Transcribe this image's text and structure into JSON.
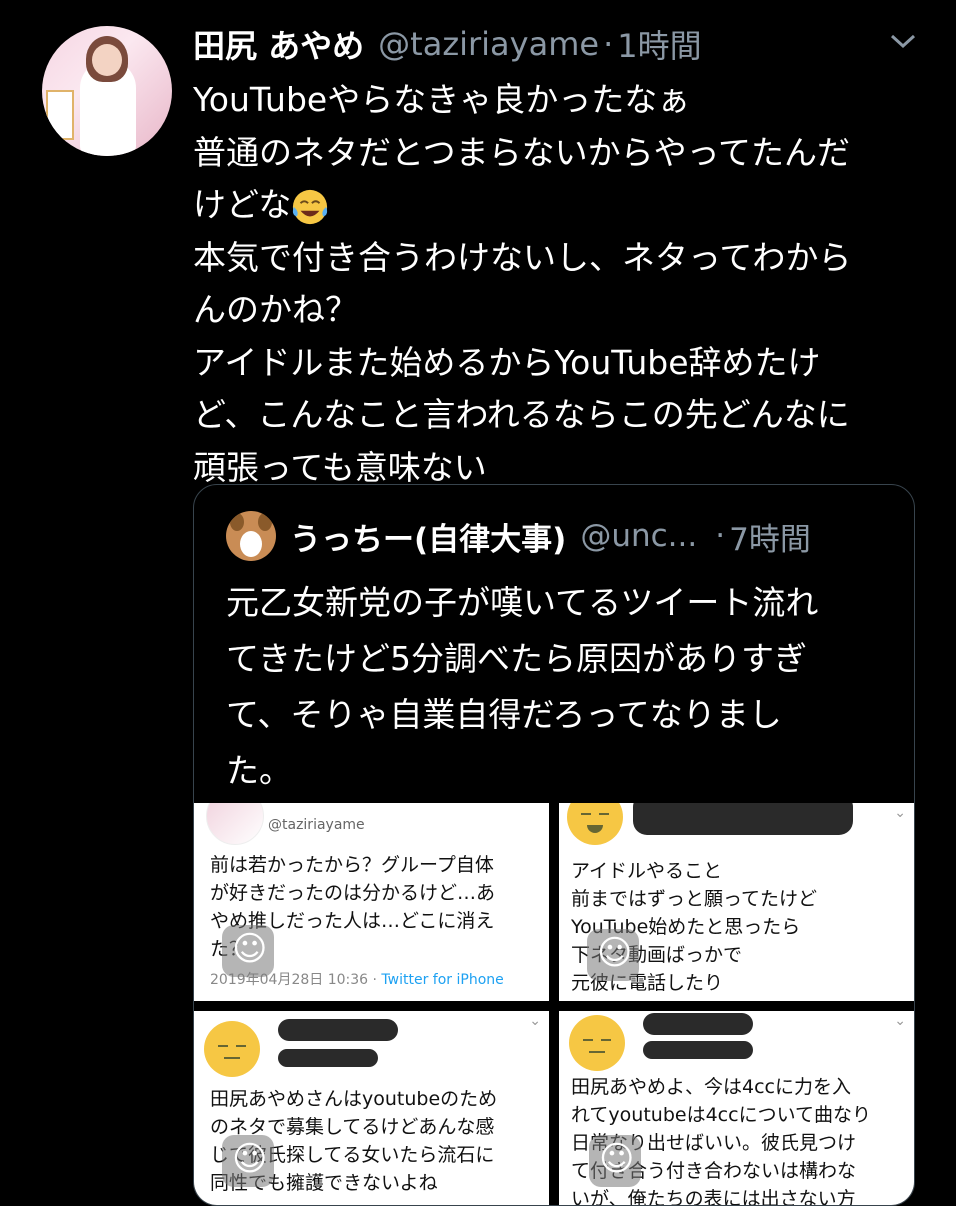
{
  "tweet": {
    "name": "田尻 あやめ",
    "handle": "@taziriayame",
    "dot": "·",
    "time": "1時間",
    "lines": [
      "YouTubeやらなきゃ良かったなぁ",
      "普通のネタだとつまらないからやってたんだ",
      "けどな",
      "本気で付き合うわけないし、ネタってわから",
      "んのかね？",
      "アイドルまた始めるからYouTube辞めたけ",
      "ど、こんなこと言われるならこの先どんなに",
      "頑張っても意味ない"
    ],
    "emoji": "face-with-tears-of-joy"
  },
  "quote": {
    "name": "うっちー(自律大事)",
    "handle": "@unc...",
    "dot": "·",
    "time": "7時間",
    "lines": [
      "元乙女新党の子が嘆いてるツイート流れ",
      "てきたけど5分調べたら原因がありすぎ",
      "て、そりゃ自業自得だろってなりまし",
      "た。"
    ]
  },
  "images": {
    "img1": {
      "handle": "@taziriayame",
      "lines": [
        "前は若かったから？グループ自体",
        "が好きだったのは分かるけど…あ",
        "やめ推しだった人は…どこに消え",
        "た？"
      ],
      "date": "2019年04月28日 10:36",
      "sep": "·",
      "source": "Twitter for iPhone"
    },
    "img2": {
      "lines": [
        "アイドルやること",
        "前まではずっと願ってたけど",
        "YouTube始めたと思ったら",
        "下ネタ動画ばっかで",
        "元彼に電話したり"
      ]
    },
    "img3": {
      "lines": [
        "田尻あやめさんはyoutubeのため",
        "のネタで募集してるけどあんな感",
        "じで彼氏探してる女いたら流石に",
        "同性でも擁護できないよね"
      ]
    },
    "img4": {
      "lines": [
        "田尻あやめよ、今は4ccに力を入",
        "れてyoutubeは4ccについて曲なり",
        "日常なり出せばいい。彼氏見つけ",
        "て付き合う付き合わないは構わな",
        "いが、俺たちの表には出さない方"
      ]
    }
  }
}
